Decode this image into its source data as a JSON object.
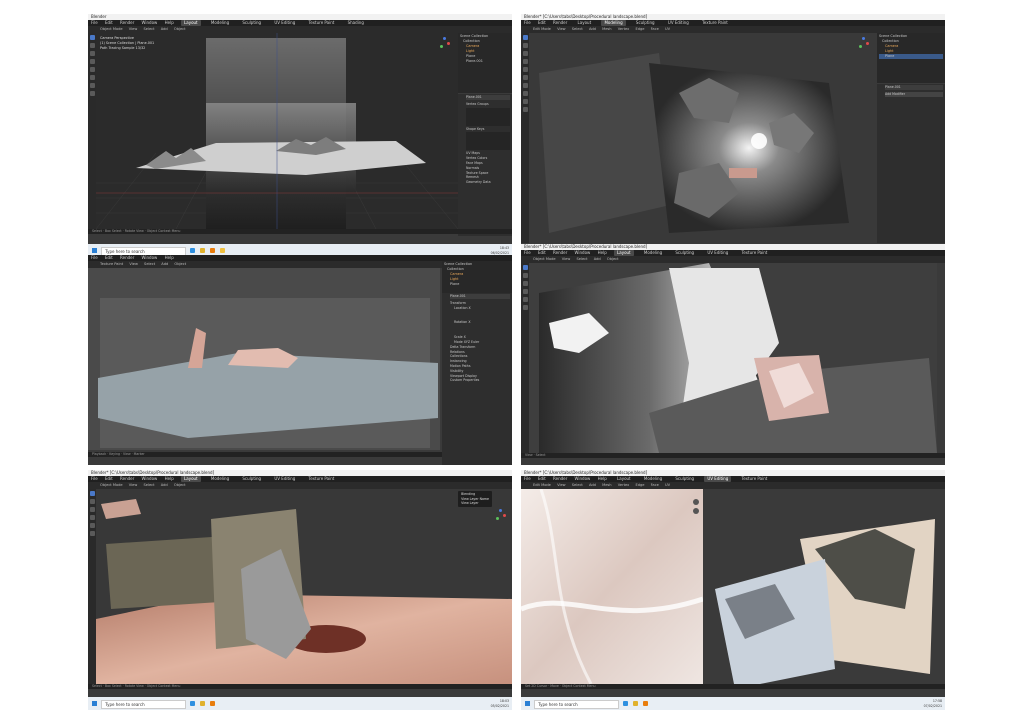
{
  "panels": [
    {
      "title": "Blender",
      "menu": [
        "File",
        "Edit",
        "Render",
        "Window",
        "Help"
      ],
      "tabs": [
        "Layout",
        "Modeling",
        "Sculpting",
        "UV Editing",
        "Texture Paint",
        "Shading",
        "Animation",
        "Rendering",
        "Compositing",
        "Scripting"
      ],
      "active_tab": "Layout",
      "mode": "Object Mode",
      "header_items": [
        "View",
        "Select",
        "Add",
        "Object"
      ],
      "overlay_text": [
        "Camera Perspective",
        "(1) Scene Collection | Plane.001",
        "Path Tracing Sample 13/32"
      ],
      "outliner": [
        "Scene Collection",
        "Collection",
        "Camera",
        "Light",
        "Plane",
        "Plane.001"
      ],
      "props": [
        "Plane.001",
        "Vertex Groups",
        "Shape Keys",
        "UV Maps",
        "Vertex Colors",
        "Face Maps",
        "Normals",
        "Texture Space",
        "Remesh",
        "Geometry Data"
      ],
      "status": [
        "Select",
        "Box Select",
        "Rotate View",
        "Object Context Menu"
      ],
      "scene": "Scene",
      "view_layer": "View Layer",
      "taskbar_search": "Type here to search",
      "time": "18:43",
      "date": "06/02/2021"
    },
    {
      "title": "Blender* [C:\\Users\\tabs\\Desktop\\Procedural landscape.blend]",
      "menu": [
        "File",
        "Edit",
        "Render",
        "Window",
        "Help"
      ],
      "tabs": [
        "Layout",
        "Modeling",
        "Sculpting",
        "UV Editing",
        "Texture Paint",
        "Shading",
        "Animation",
        "Rendering",
        "Compositing",
        "Scripting"
      ],
      "active_tab": "Modeling",
      "mode": "Edit Mode",
      "header_items": [
        "View",
        "Select",
        "Add",
        "Mesh",
        "Vertex",
        "Edge",
        "Face",
        "UV"
      ],
      "outliner": [
        "Scene Collection",
        "Collection",
        "Camera",
        "Light",
        "Plane"
      ],
      "props": [
        "Plane.001",
        "Add Modifier"
      ],
      "status": [],
      "scene": "Scene",
      "view_layer": "View Layer",
      "taskbar_search": "Type here to search",
      "time": "",
      "date": ""
    },
    {
      "title": "",
      "menu": [
        "File",
        "Edit",
        "Render",
        "Window",
        "Help"
      ],
      "tabs": [
        "Layout",
        "Modeling",
        "Sculpting"
      ],
      "active_tab": "Layout",
      "mode": "Texture Paint",
      "header_items": [
        "View",
        "Select",
        "Add",
        "Object"
      ],
      "outliner": [
        "Scene Collection",
        "Collection",
        "Camera",
        "Light",
        "Plane"
      ],
      "props": [
        "Plane.001",
        "Transform",
        "Location X",
        "Rotation X",
        "Scale X",
        "Mode XYZ Euler",
        "Delta Transform",
        "Relations",
        "Collections",
        "Instancing",
        "Motion Paths",
        "Visibility",
        "Viewport Display",
        "Custom Properties"
      ],
      "status": [
        "Playback",
        "Keying",
        "View",
        "Marker"
      ],
      "scene": "Scene",
      "view_layer": "View Layer",
      "taskbar_search": "Type here to search",
      "time": "",
      "date": ""
    },
    {
      "title": "Blender* [C:\\Users\\tabs\\Desktop\\Procedural landscape.blend]",
      "menu": [
        "File",
        "Edit",
        "Render",
        "Window",
        "Help"
      ],
      "tabs": [
        "Layout",
        "Modeling",
        "Sculpting",
        "UV Editing",
        "Texture Paint",
        "Shading",
        "Animation",
        "Rendering",
        "Compositing",
        "Scripting"
      ],
      "active_tab": "Layout",
      "mode": "Object Mode",
      "header_items": [
        "View",
        "Select",
        "Add",
        "Object"
      ],
      "outliner": [],
      "props": [],
      "status": [
        "View",
        "Select"
      ],
      "scene": "Scene",
      "view_layer": "View Layer",
      "taskbar_search": "",
      "time": "",
      "date": ""
    },
    {
      "title": "Blender* [C:\\Users\\tabs\\Desktop\\Procedural landscape.blend]",
      "menu": [
        "File",
        "Edit",
        "Render",
        "Window",
        "Help"
      ],
      "tabs": [
        "Layout",
        "Modeling",
        "Sculpting",
        "UV Editing",
        "Texture Paint",
        "Shading",
        "Animation",
        "Rendering",
        "Compositing",
        "Scripting"
      ],
      "active_tab": "Layout",
      "mode": "Object Mode",
      "header_items": [
        "View",
        "Select",
        "Add",
        "Object"
      ],
      "tooltip": [
        "Blending",
        "View Layer Name",
        "View Layer"
      ],
      "status": [
        "Select",
        "Box Select",
        "Rotate View",
        "Object Context Menu"
      ],
      "scene": "Scene",
      "view_layer": "View Layer",
      "taskbar_search": "Type here to search",
      "time": "18:03",
      "date": "05/02/2021"
    },
    {
      "title": "Blender* [C:\\Users\\tabs\\Desktop\\Procedural landscape.blend]",
      "menu": [
        "File",
        "Edit",
        "Render",
        "Window",
        "Help"
      ],
      "tabs": [
        "Layout",
        "Modeling",
        "Sculpting",
        "UV Editing",
        "Texture Paint",
        "Shading",
        "Animation",
        "Rendering",
        "Compositing",
        "Scripting"
      ],
      "active_tab": "UV Editing",
      "mode": "Edit Mode",
      "header_items": [
        "View",
        "Select",
        "Add",
        "Mesh",
        "Vertex",
        "Edge",
        "Face",
        "UV"
      ],
      "status": [
        "Set 2D Cursor",
        "Move",
        "Object Context Menu"
      ],
      "scene": "Scene",
      "view_layer": "View Layer",
      "taskbar_search": "Type here to search",
      "time": "17:58",
      "date": "07/02/2021"
    }
  ],
  "colors": {
    "viewport": "#3d3d3d",
    "accent": "#4a79c9",
    "skin": "#d9a89a",
    "rock": "#7a7a7a",
    "pale": "#e8e6e2"
  }
}
